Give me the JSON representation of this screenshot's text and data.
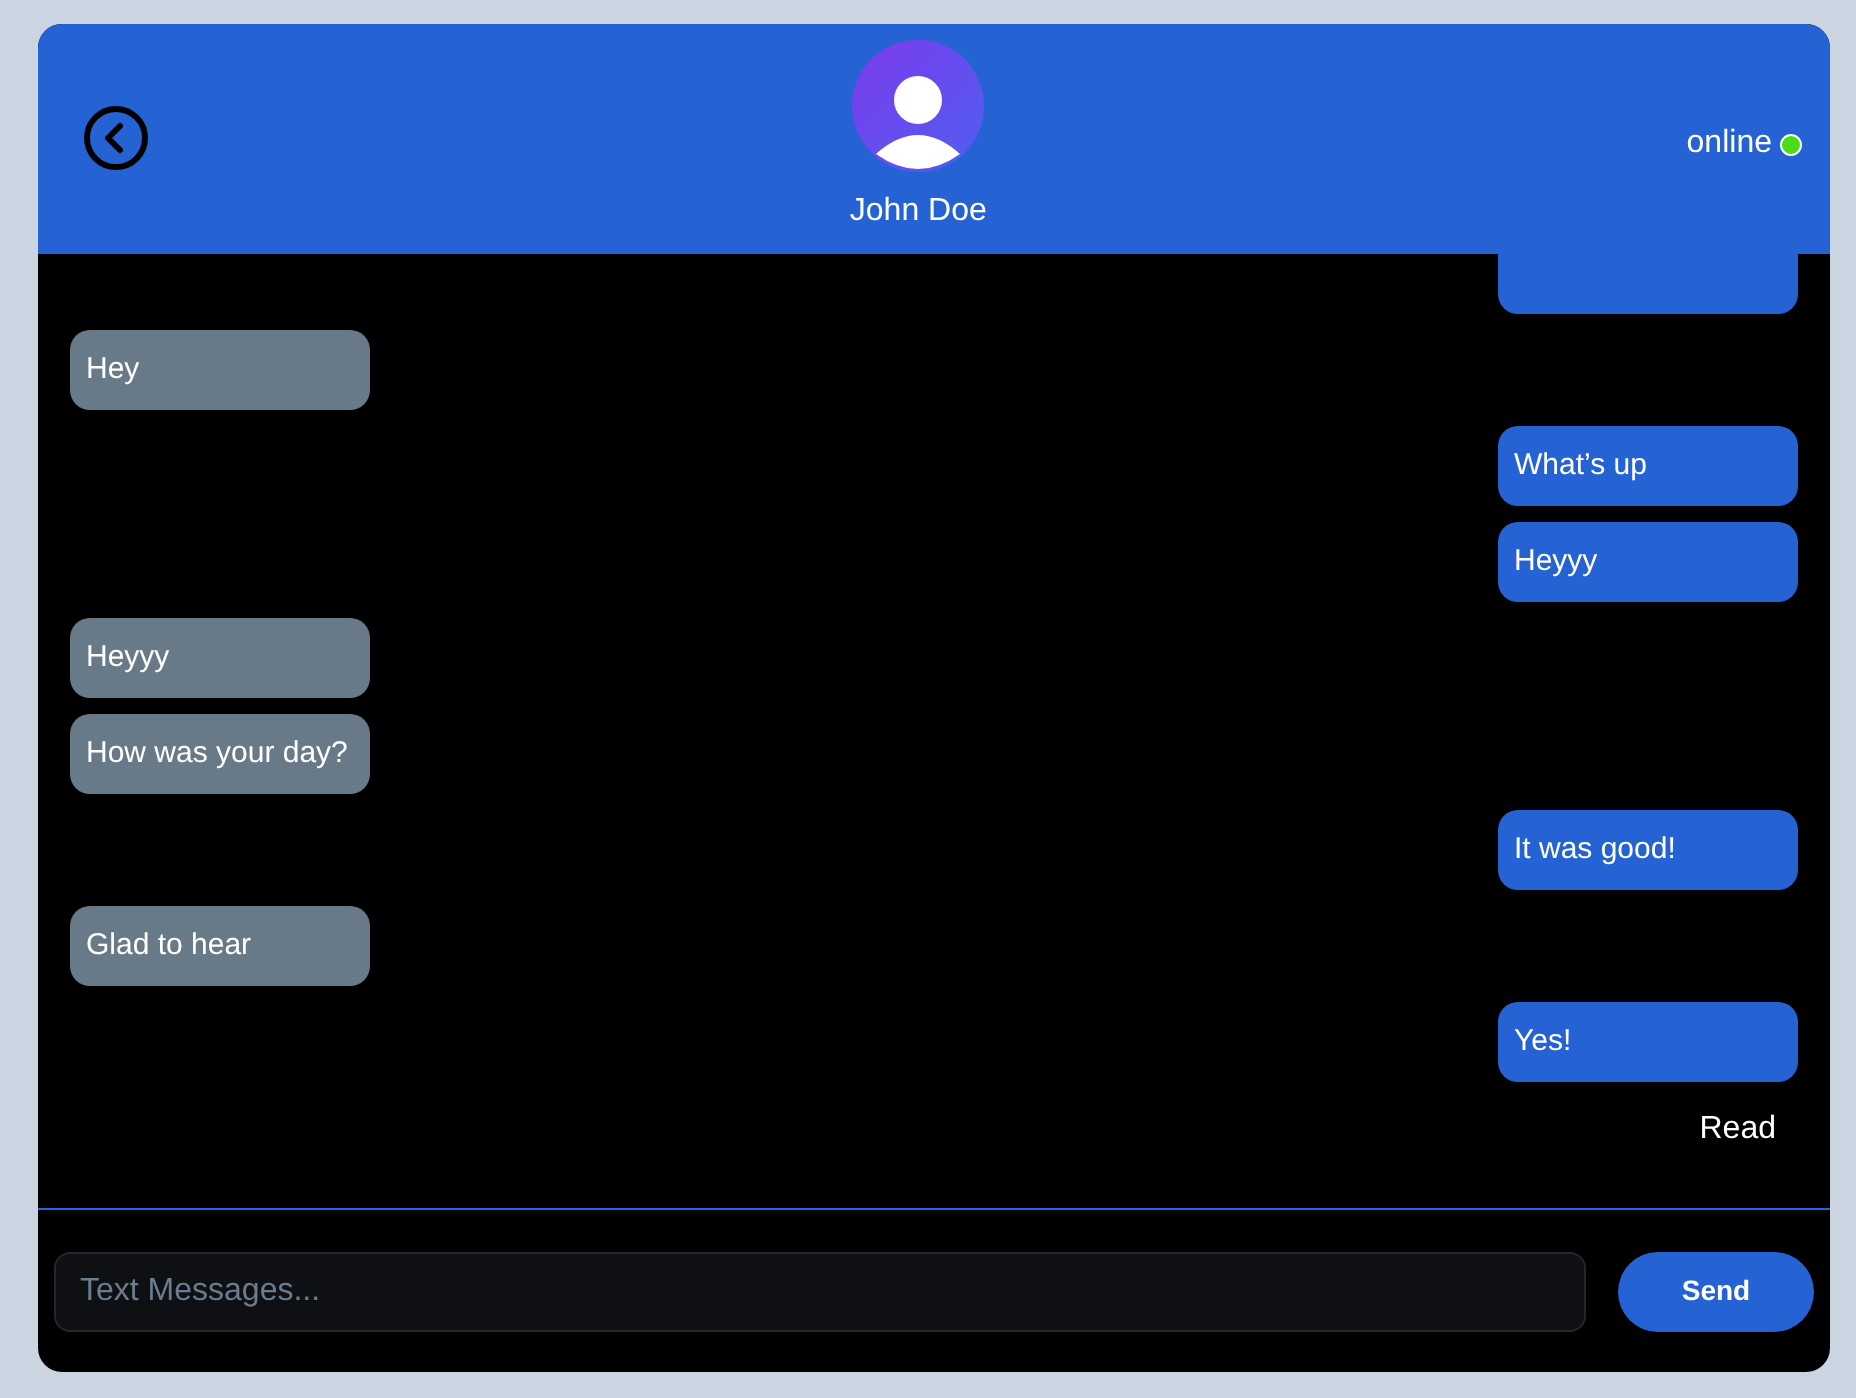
{
  "header": {
    "name": "John Doe",
    "status": "online",
    "online": true
  },
  "messages": [
    {
      "kind": "sent"
    },
    {
      "kind": "received",
      "text": "Hey"
    },
    {
      "kind": "sent",
      "text": "What’s up"
    },
    {
      "kind": "sent",
      "text": "Heyyy"
    },
    {
      "kind": "received",
      "text": "Heyyy"
    },
    {
      "kind": "received",
      "text": "How was your day?"
    },
    {
      "kind": "sent",
      "text": "It was good!"
    },
    {
      "kind": "received",
      "text": "Glad to hear"
    },
    {
      "kind": "sent",
      "text": "Yes!"
    }
  ],
  "receipt": "Read",
  "composer": {
    "placeholder": "Text Messages...",
    "button": "Send"
  }
}
